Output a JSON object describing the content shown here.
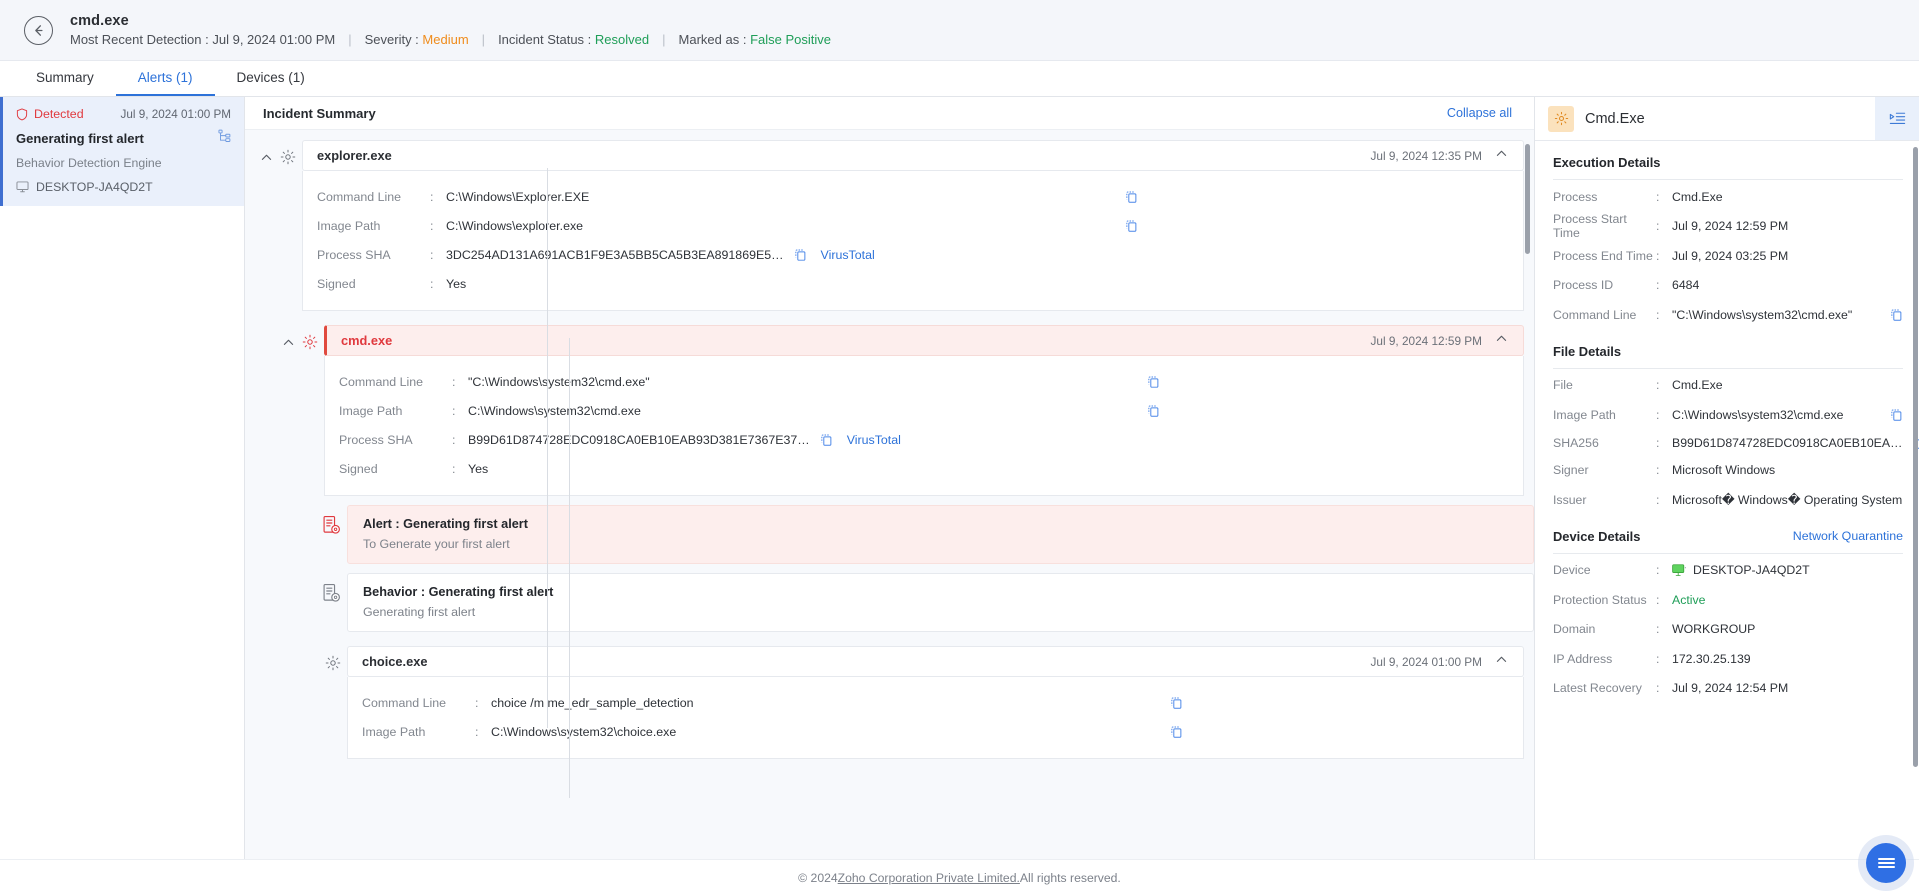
{
  "header": {
    "back_icon": "arrow-left-icon",
    "title": "cmd.exe",
    "meta": {
      "detection_label": "Most Recent Detection :",
      "detection_value": "Jul 9, 2024 01:00 PM",
      "severity_label": "Severity :",
      "severity_value": "Medium",
      "status_label": "Incident Status :",
      "status_value": "Resolved",
      "marked_label": "Marked as :",
      "marked_value": "False Positive",
      "separator": "|"
    }
  },
  "tabs": [
    {
      "label": "Summary",
      "active": false
    },
    {
      "label": "Alerts (1)",
      "active": true
    },
    {
      "label": "Devices (1)",
      "active": false
    }
  ],
  "alert_list": [
    {
      "status": "Detected",
      "status_icon": "shield-alert-icon",
      "time": "Jul 9, 2024 01:00 PM",
      "name": "Generating first alert",
      "tree_icon": "process-tree-icon",
      "engine": "Behavior Detection Engine",
      "device_icon": "monitor-icon",
      "device": "DESKTOP-JA4QD2T"
    }
  ],
  "center": {
    "title": "Incident Summary",
    "collapse_all": "Collapse all",
    "colon": ":",
    "virustotal_label": "VirusTotal",
    "copy_icon": "copy-icon",
    "gear_icon": "gear-icon",
    "caret_icon": "chevron-up-icon",
    "processes": [
      {
        "name": "explorer.exe",
        "time": "Jul 9, 2024 12:35 PM",
        "alerted": false,
        "fields": [
          {
            "key": "Command Line",
            "value": "C:\\Windows\\Explorer.EXE",
            "copy": true,
            "virustotal": false
          },
          {
            "key": "Image Path",
            "value": "C:\\Windows\\explorer.exe",
            "copy": true,
            "virustotal": false
          },
          {
            "key": "Process SHA",
            "value": "3DC254AD131A691ACB1F9E3A5BB5CA5B3EA891869E5…",
            "copy": true,
            "virustotal": true
          },
          {
            "key": "Signed",
            "value": "Yes",
            "copy": false,
            "virustotal": false
          }
        ]
      },
      {
        "name": "cmd.exe",
        "time": "Jul 9, 2024 12:59 PM",
        "alerted": true,
        "fields": [
          {
            "key": "Command Line",
            "value": "\"C:\\Windows\\system32\\cmd.exe\"",
            "copy": true,
            "virustotal": false
          },
          {
            "key": "Image Path",
            "value": "C:\\Windows\\system32\\cmd.exe",
            "copy": true,
            "virustotal": false
          },
          {
            "key": "Process SHA",
            "value": "B99D61D874728EDC0918CA0EB10EAB93D381E7367E37…",
            "copy": true,
            "virustotal": true
          },
          {
            "key": "Signed",
            "value": "Yes",
            "copy": false,
            "virustotal": false
          }
        ]
      }
    ],
    "events": [
      {
        "icon": "alert-document-icon",
        "title": "Alert : Generating first alert",
        "subtitle": "To Generate your first alert",
        "alerted": true
      },
      {
        "icon": "behavior-document-icon",
        "title": "Behavior : Generating first alert",
        "subtitle": "Generating first alert",
        "alerted": false
      }
    ],
    "child_process": {
      "name": "choice.exe",
      "time": "Jul 9, 2024 01:00 PM",
      "alerted": false,
      "fields": [
        {
          "key": "Command Line",
          "value": "choice /m me_edr_sample_detection",
          "copy": true,
          "virustotal": false
        },
        {
          "key": "Image Path",
          "value": "C:\\Windows\\system32\\choice.exe",
          "copy": true,
          "virustotal": false
        }
      ]
    }
  },
  "right_panel": {
    "icon": "gear-icon",
    "title": "Cmd.Exe",
    "expand_icon": "panel-expand-icon",
    "colon": ":",
    "copy_icon": "copy-icon",
    "sections": [
      {
        "title": "Execution Details",
        "action": "",
        "rows": [
          {
            "key": "Process",
            "value": "Cmd.Exe",
            "copy": false
          },
          {
            "key": "Process Start Time",
            "value": "Jul 9, 2024 12:59 PM",
            "copy": false
          },
          {
            "key": "Process End Time",
            "value": "Jul 9, 2024 03:25 PM",
            "copy": false
          },
          {
            "key": "Process ID",
            "value": "6484",
            "copy": false
          },
          {
            "key": "Command Line",
            "value": "\"C:\\Windows\\system32\\cmd.exe\"",
            "copy": true
          }
        ]
      },
      {
        "title": "File Details",
        "action": "",
        "rows": [
          {
            "key": "File",
            "value": "Cmd.Exe",
            "copy": false
          },
          {
            "key": "Image Path",
            "value": "C:\\Windows\\system32\\cmd.exe",
            "copy": true
          },
          {
            "key": "SHA256",
            "value": "B99D61D874728EDC0918CA0EB10EA…",
            "copy": true
          },
          {
            "key": "Signer",
            "value": "Microsoft Windows",
            "copy": false
          },
          {
            "key": "Issuer",
            "value": "Microsoft� Windows� Operating System",
            "copy": false
          }
        ]
      },
      {
        "title": "Device Details",
        "action": "Network Quarantine",
        "rows": [
          {
            "key": "Device",
            "value": "DESKTOP-JA4QD2T",
            "copy": false,
            "device_icon": "monitor-online-icon"
          },
          {
            "key": "Protection Status",
            "value": "Active",
            "copy": false,
            "status": "active"
          },
          {
            "key": "Domain",
            "value": "WORKGROUP",
            "copy": false
          },
          {
            "key": "IP Address",
            "value": "172.30.25.139",
            "copy": false
          },
          {
            "key": "Latest Recovery",
            "value": "Jul 9, 2024 12:54 PM",
            "copy": false
          }
        ]
      }
    ]
  },
  "footer": {
    "prefix": "© 2024 ",
    "link": "Zoho Corporation Private Limited.",
    "suffix": " All rights reserved."
  },
  "fab": {
    "icon": "menu-icon"
  },
  "colors": {
    "accent": "#2d72d9",
    "severity_medium": "#ef8c1c",
    "resolved_green": "#1f9e58",
    "alert_red": "#e0393e",
    "alert_bg": "#fdeeed"
  }
}
